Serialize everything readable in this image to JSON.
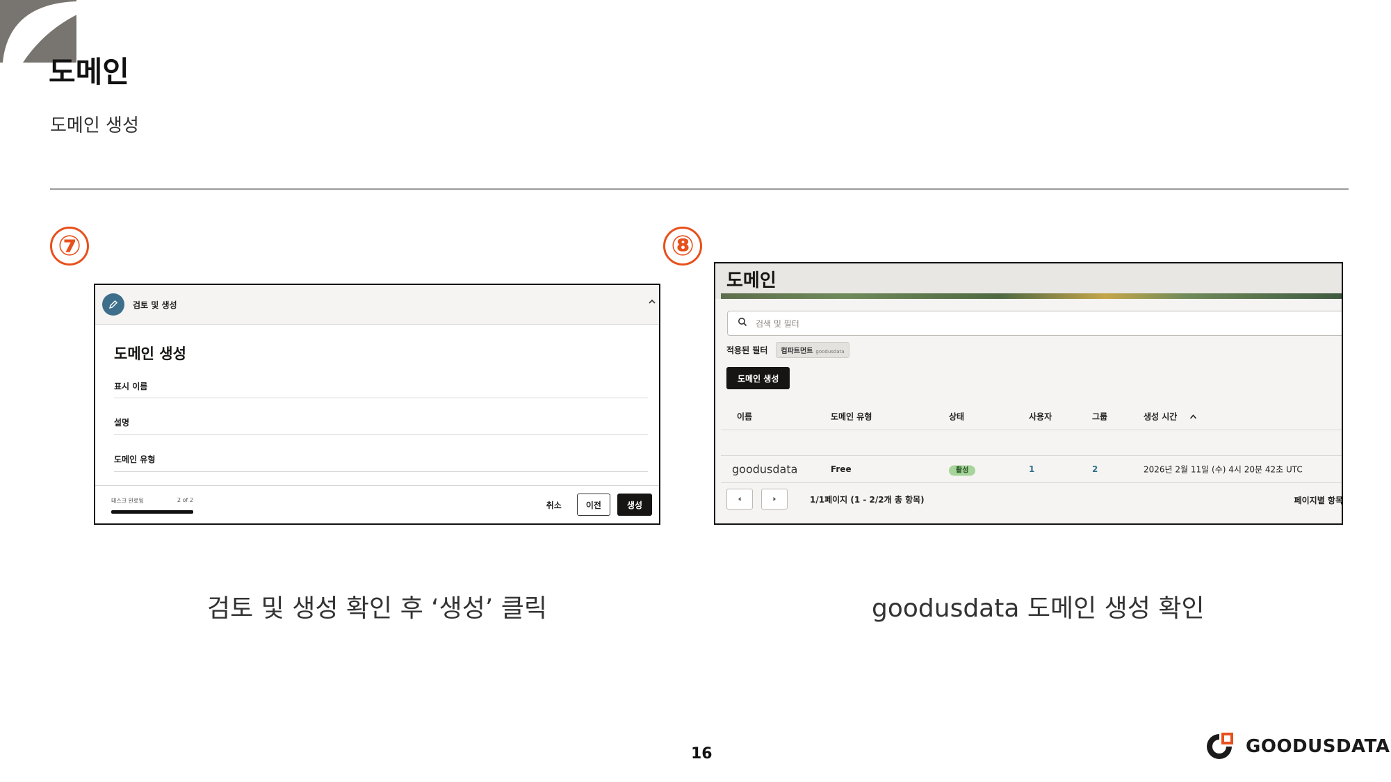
{
  "slide": {
    "title": "도메인",
    "subtitle": "도메인 생성",
    "page_number": "16",
    "accent_color": "#e8501b"
  },
  "step7": {
    "badge": "⑦",
    "header_label": "검토 및 생성",
    "heading": "도메인 생성",
    "fields": [
      "표시 이름",
      "설명",
      "도메인 유형"
    ],
    "progress_label": "태스크 완료됨",
    "progress_count": "2 of 2",
    "progress_fraction": 1.0,
    "cancel_label": "취소",
    "prev_label": "이전",
    "create_label": "생성",
    "caption": "검토 및 생성 확인 후 ‘생성’ 클릭"
  },
  "step8": {
    "badge": "⑧",
    "title": "도메인",
    "search_placeholder": "검색 및 필터",
    "applied_filters_label": "적용된 필터",
    "filter_chip": "컴파트먼트",
    "filter_chip_value": "goodusdata",
    "create_button": "도메인 생성",
    "columns": [
      "이름",
      "도메인 유형",
      "상태",
      "사용자",
      "그룹",
      "생성 시간"
    ],
    "rows": [
      {
        "name": "goodusdata",
        "type": "Free",
        "status": "활성",
        "users": "1",
        "groups": "2",
        "created": "2026년 2월 11일 (수) 4시 20분 42초 UTC"
      }
    ],
    "pager_text": "1/1페이지 (1 - 2/2개 총 항목)",
    "per_page_label": "페이지별 항목",
    "caption": "goodusdata 도메인 생성 확인"
  },
  "logo": {
    "text": "GOODUSDATA"
  }
}
